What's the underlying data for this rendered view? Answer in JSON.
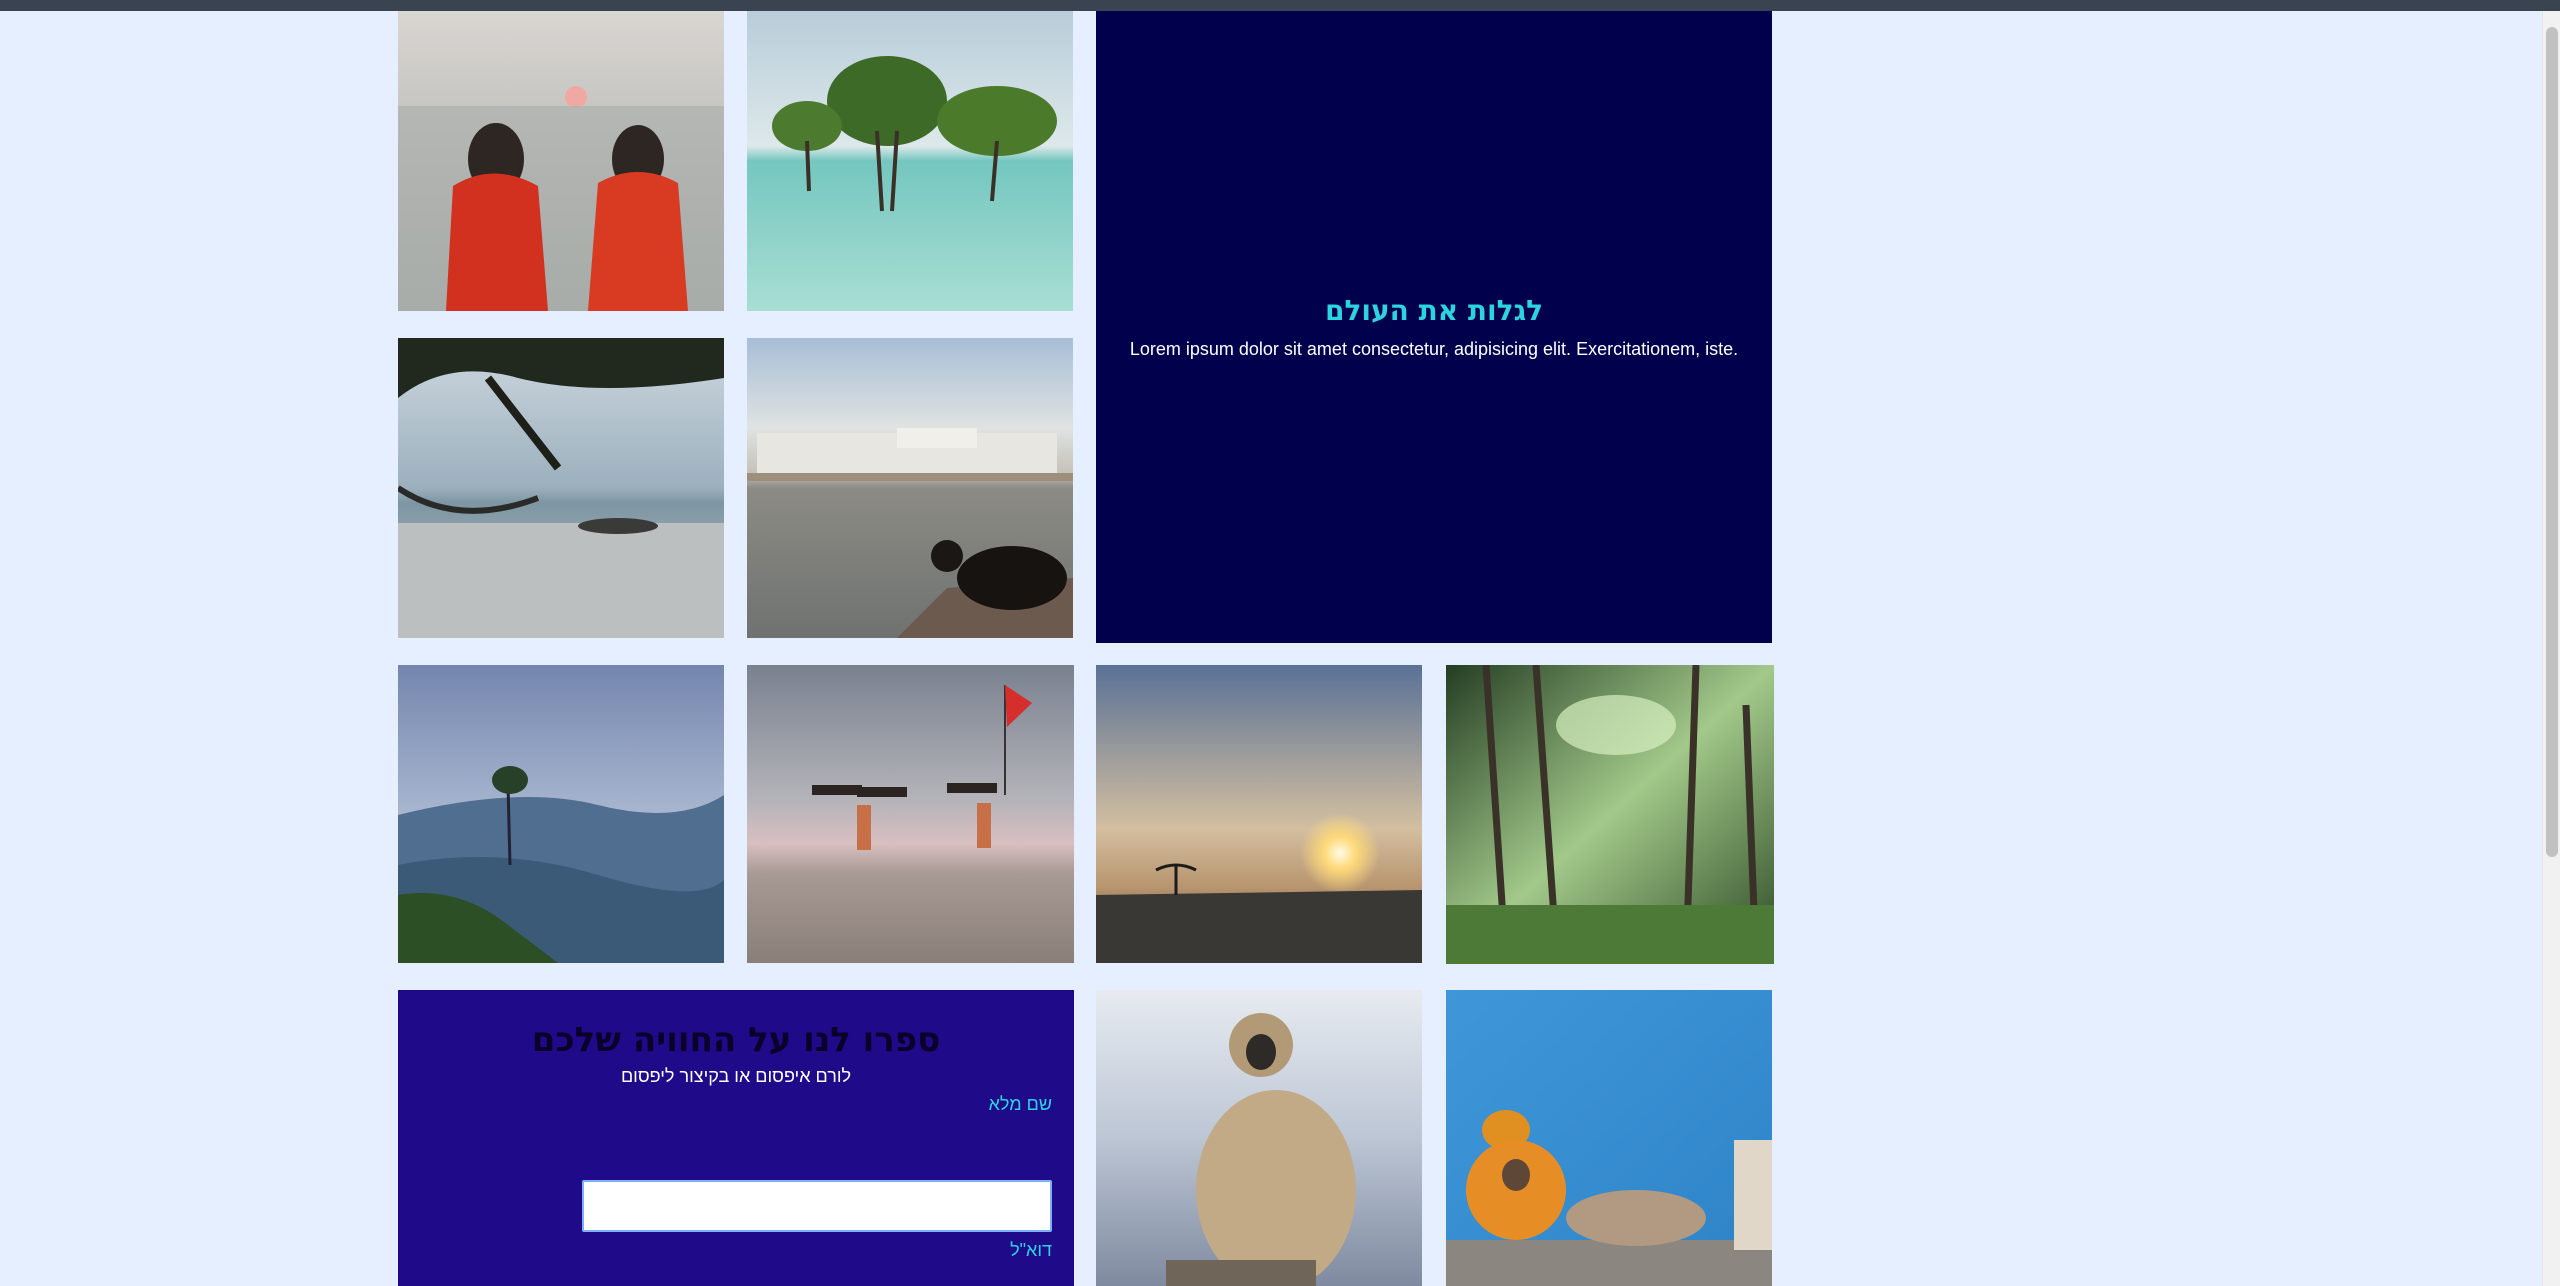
{
  "hero": {
    "title": "לגלות את העולם",
    "text": "Lorem ipsum dolor sit amet consectetur, adipisicing elit. Exercitationem, iste."
  },
  "feedback": {
    "title": "ספרו לנו על החוויה שלכם",
    "subtitle": "לורם איפסום או בקיצור ליפסום",
    "name_label": "שם מלא",
    "email_label": "דוא\"ל",
    "name_value": ""
  },
  "gallery": [
    {
      "name": "women-sunset-photo",
      "icon": "photo"
    },
    {
      "name": "mangrove-trees-photo",
      "icon": "photo"
    },
    {
      "name": "beach-hammock-photo",
      "icon": "photo"
    },
    {
      "name": "cow-lake-town-photo",
      "icon": "photo"
    },
    {
      "name": "misty-mountains-photo",
      "icon": "photo"
    },
    {
      "name": "beach-carriers-flag-photo",
      "icon": "photo"
    },
    {
      "name": "sunset-shore-photo",
      "icon": "photo"
    },
    {
      "name": "palm-forest-photo",
      "icon": "photo"
    },
    {
      "name": "monkey-photo",
      "icon": "photo"
    },
    {
      "name": "sadhu-blue-wall-photo",
      "icon": "photo"
    }
  ],
  "colors": {
    "page_bg": "#e6efff",
    "hero_bg": "#00004d",
    "accent": "#2ed3e0",
    "form_bg": "#1f0a8a"
  }
}
